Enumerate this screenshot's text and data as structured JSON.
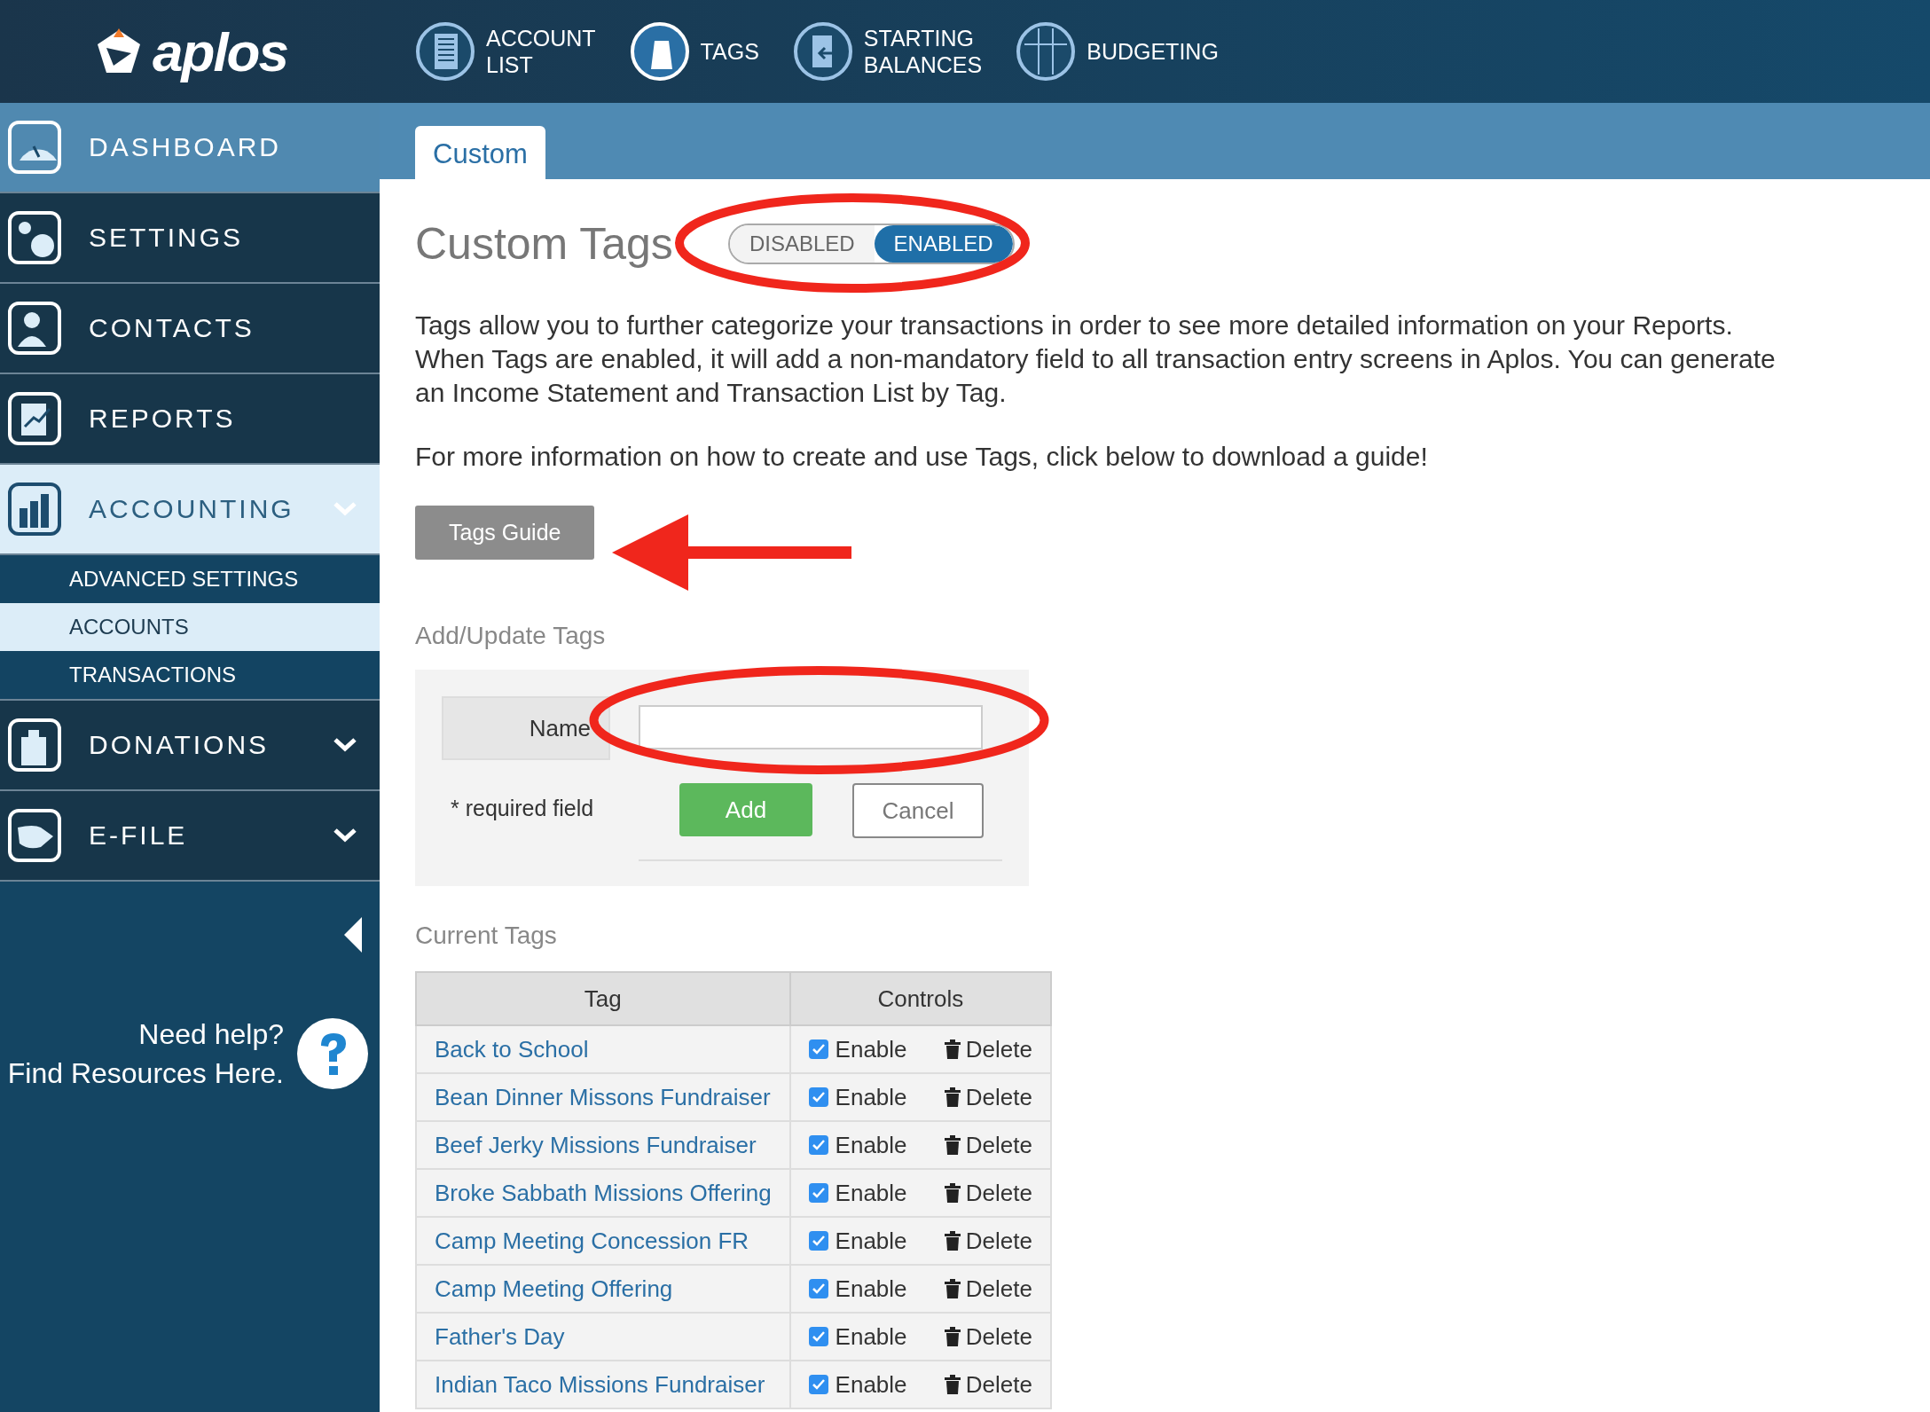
{
  "header": {
    "logo": "aplos",
    "nav": [
      {
        "lines": [
          "ACCOUNT",
          "LIST"
        ]
      },
      {
        "lines": [
          "TAGS"
        ]
      },
      {
        "lines": [
          "STARTING",
          "BALANCES"
        ]
      },
      {
        "lines": [
          "BUDGETING"
        ]
      }
    ]
  },
  "sidebar": {
    "items": [
      {
        "label": "DASHBOARD",
        "selected": true,
        "expanded": false,
        "has_children": false
      },
      {
        "label": "SETTINGS",
        "selected": false,
        "expanded": false,
        "has_children": false
      },
      {
        "label": "CONTACTS",
        "selected": false,
        "expanded": false,
        "has_children": false
      },
      {
        "label": "REPORTS",
        "selected": false,
        "expanded": false,
        "has_children": false
      },
      {
        "label": "ACCOUNTING",
        "selected": false,
        "expanded": true,
        "has_children": true,
        "children": [
          {
            "label": "ADVANCED SETTINGS",
            "selected": false
          },
          {
            "label": "ACCOUNTS",
            "selected": true
          },
          {
            "label": "TRANSACTIONS",
            "selected": false
          }
        ]
      },
      {
        "label": "DONATIONS",
        "selected": false,
        "expanded": false,
        "has_children": true
      },
      {
        "label": "E-FILE",
        "selected": false,
        "expanded": false,
        "has_children": true
      }
    ],
    "help": [
      "Need help?",
      "Find Resources Here."
    ]
  },
  "tabs": [
    {
      "label": "Custom",
      "selected": true
    }
  ],
  "title": "Custom Tags",
  "toggle": [
    {
      "label": "DISABLED",
      "selected": false
    },
    {
      "label": "ENABLED",
      "selected": true
    }
  ],
  "description": "Tags allow you to further categorize your transactions in order to see more detailed information on your Reports. When Tags are enabled, it will add a non-mandatory field to all transaction entry screens in Aplos. You can generate an Income Statement and Transaction List by Tag.",
  "guide_text": "For more information on how to create and use Tags, click below to download a guide!",
  "guide_button": "Tags Guide",
  "form": {
    "heading": "Add/Update Tags",
    "name_label": "Name",
    "required_note": "* required field",
    "add": "Add",
    "cancel": "Cancel"
  },
  "table": {
    "heading": "Current Tags",
    "columns": [
      "Tag",
      "Controls"
    ],
    "rows": [
      {
        "name": "Back to School",
        "enabled": true,
        "enable_label": "Enable",
        "delete_label": "Delete"
      },
      {
        "name": "Bean Dinner Missons Fundraiser",
        "enabled": true,
        "enable_label": "Enable",
        "delete_label": "Delete"
      },
      {
        "name": "Beef Jerky Missions Fundraiser",
        "enabled": true,
        "enable_label": "Enable",
        "delete_label": "Delete"
      },
      {
        "name": "Broke Sabbath Missions Offering",
        "enabled": true,
        "enable_label": "Enable",
        "delete_label": "Delete"
      },
      {
        "name": "Camp Meeting Concession FR",
        "enabled": true,
        "enable_label": "Enable",
        "delete_label": "Delete"
      },
      {
        "name": "Camp Meeting Offering",
        "enabled": true,
        "enable_label": "Enable",
        "delete_label": "Delete"
      },
      {
        "name": "Father's Day",
        "enabled": true,
        "enable_label": "Enable",
        "delete_label": "Delete"
      },
      {
        "name": "Indian Taco Missions Fundraiser",
        "enabled": true,
        "enable_label": "Enable",
        "delete_label": "Delete"
      }
    ]
  }
}
